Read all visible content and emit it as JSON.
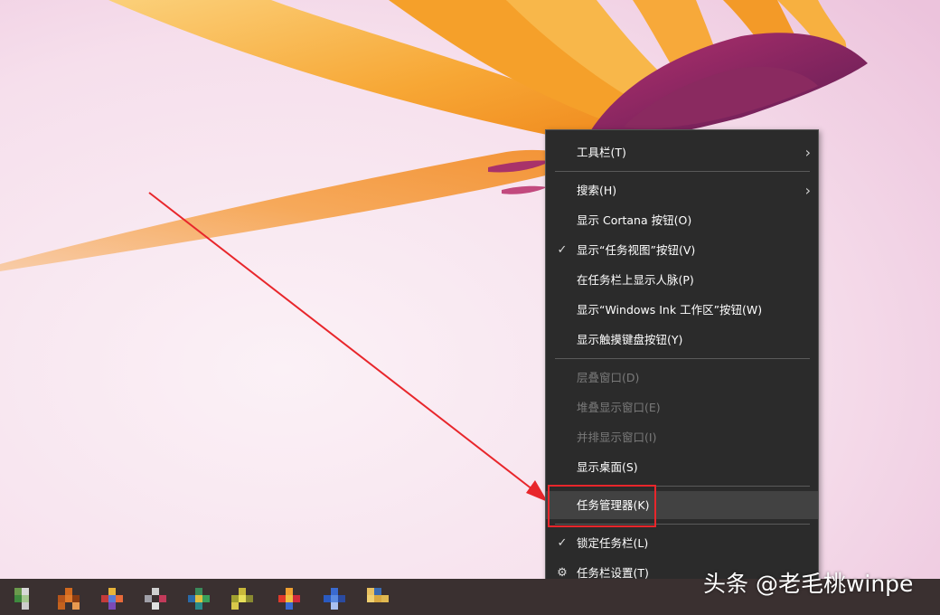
{
  "context_menu": {
    "items": [
      {
        "label": "工具栏(T)"
      },
      {
        "label": "搜索(H)"
      },
      {
        "label": "显示 Cortana 按钮(O)"
      },
      {
        "label": "显示“任务视图”按钮(V)"
      },
      {
        "label": "在任务栏上显示人脉(P)"
      },
      {
        "label": "显示“Windows Ink 工作区”按钮(W)"
      },
      {
        "label": "显示触摸键盘按钮(Y)"
      },
      {
        "label": "层叠窗口(D)"
      },
      {
        "label": "堆叠显示窗口(E)"
      },
      {
        "label": "并排显示窗口(I)"
      },
      {
        "label": "显示桌面(S)"
      },
      {
        "label": "任务管理器(K)"
      },
      {
        "label": "锁定任务栏(L)"
      },
      {
        "label": "任务栏设置(T)"
      }
    ],
    "glyphs": {
      "check": "✓",
      "chevron": "›",
      "gear": "⚙"
    },
    "highlighted_item": "任务管理器(K)"
  },
  "watermark": {
    "text": "头条 @老毛桃winpe"
  },
  "colors": {
    "menu_bg": "#2b2b2b",
    "menu_text": "#ffffff",
    "menu_disabled": "#7a7a7a",
    "annotation_red": "#e8262b",
    "taskbar_bg": "#3a3030",
    "petal_orange": "#f59a2a"
  }
}
